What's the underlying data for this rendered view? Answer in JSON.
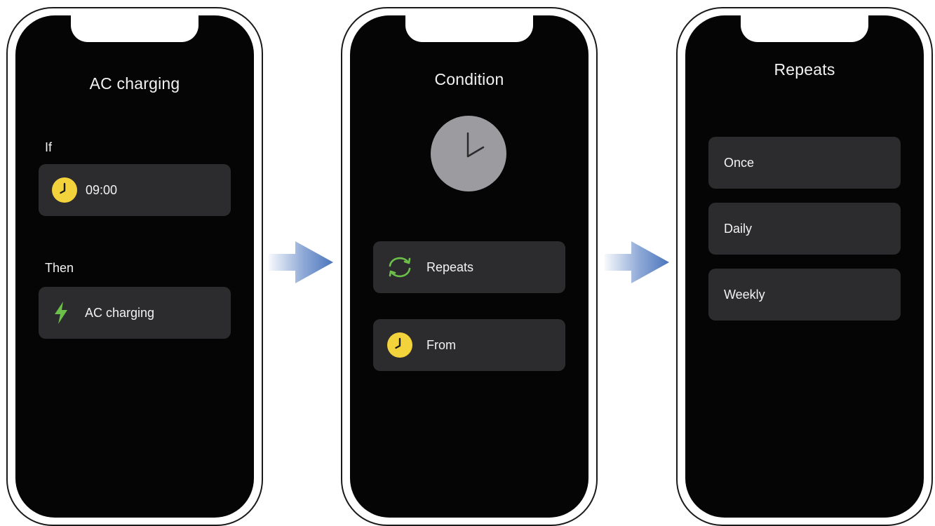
{
  "phone1": {
    "title": "AC charging",
    "if_label": "If",
    "then_label": "Then",
    "if_card": {
      "icon": "clock-icon",
      "text": "09:00"
    },
    "then_card": {
      "icon": "lightning-icon",
      "text": "AC charging"
    }
  },
  "phone2": {
    "title": "Condition",
    "hero_icon": "clock-icon",
    "repeats_card": {
      "icon": "repeat-icon",
      "text": "Repeats"
    },
    "from_card": {
      "icon": "clock-icon",
      "text": "From"
    }
  },
  "phone3": {
    "title": "Repeats",
    "options": [
      "Once",
      "Daily",
      "Weekly"
    ]
  },
  "colors": {
    "screen": "#050505",
    "card": "#2c2c2e",
    "text": "#f2f2f2",
    "clock_yellow": "#f2d33c",
    "accent_green": "#6cc04a",
    "hero_clock_gray": "#9c9ca0",
    "arrow_blue": "#5b82c4"
  }
}
